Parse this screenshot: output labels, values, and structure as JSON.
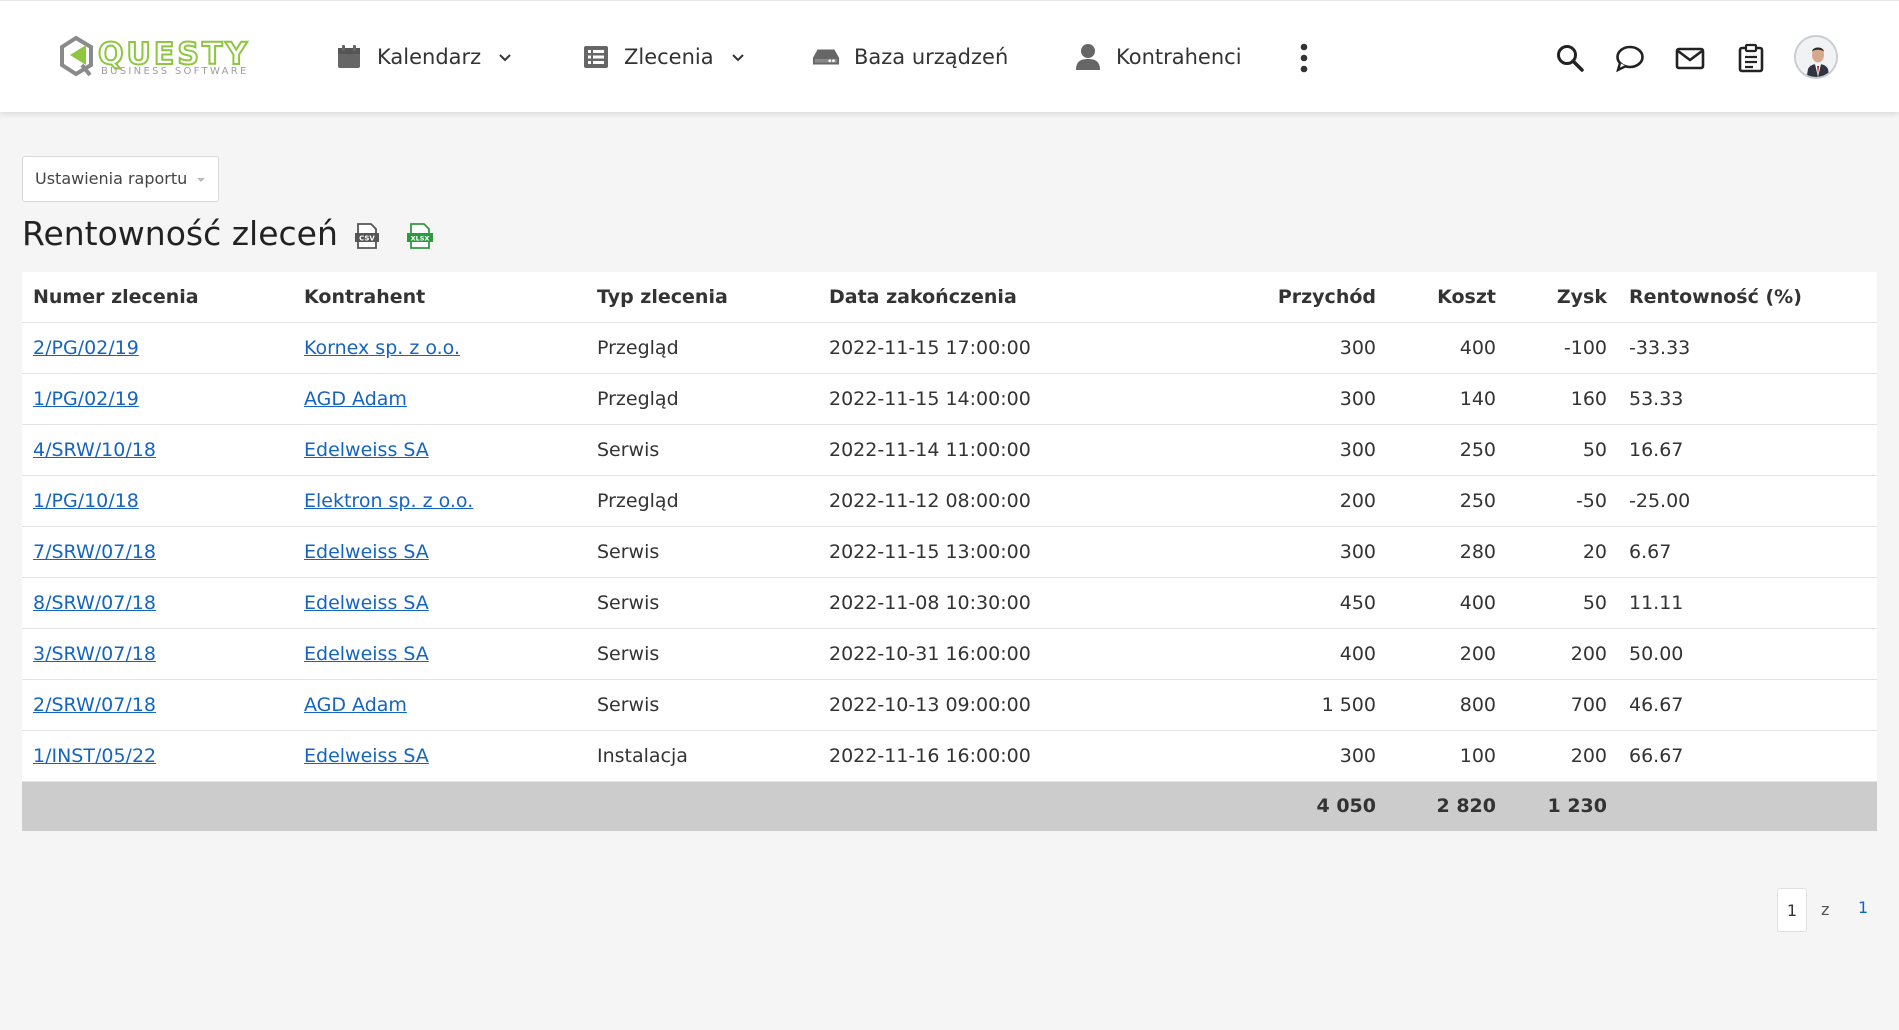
{
  "logo": {
    "name": "QUESTY",
    "tagline": "BUSINESS SOFTWARE",
    "color": "#8dc63f"
  },
  "nav": {
    "items": [
      {
        "label": "Kalendarz",
        "icon": "calendar-icon",
        "dropdown": true
      },
      {
        "label": "Zlecenia",
        "icon": "list-icon",
        "dropdown": true
      },
      {
        "label": "Baza urządzeń",
        "icon": "device-icon",
        "dropdown": false
      },
      {
        "label": "Kontrahenci",
        "icon": "person-icon",
        "dropdown": false
      }
    ],
    "right_icons": [
      "search-icon",
      "chat-icon",
      "mail-icon",
      "clipboard-icon"
    ]
  },
  "report": {
    "settings_label": "Ustawienia raportu",
    "title": "Rentowność zleceń",
    "export_icons": [
      "csv-export-icon",
      "xlsx-export-icon"
    ],
    "columns": [
      "Numer zlecenia",
      "Kontrahent",
      "Typ zlecenia",
      "Data zakończenia",
      "Przychód",
      "Koszt",
      "Zysk",
      "Rentowność (%)"
    ],
    "rows": [
      [
        "2/PG/02/19",
        "Kornex sp. z o.o.",
        "Przegląd",
        "2022-11-15 17:00:00",
        "300",
        "400",
        "-100",
        "-33.33"
      ],
      [
        "1/PG/02/19",
        "AGD Adam",
        "Przegląd",
        "2022-11-15 14:00:00",
        "300",
        "140",
        "160",
        "53.33"
      ],
      [
        "4/SRW/10/18",
        "Edelweiss SA",
        "Serwis",
        "2022-11-14 11:00:00",
        "300",
        "250",
        "50",
        "16.67"
      ],
      [
        "1/PG/10/18",
        "Elektron sp. z o.o.",
        "Przegląd",
        "2022-11-12 08:00:00",
        "200",
        "250",
        "-50",
        "-25.00"
      ],
      [
        "7/SRW/07/18",
        "Edelweiss SA",
        "Serwis",
        "2022-11-15 13:00:00",
        "300",
        "280",
        "20",
        "6.67"
      ],
      [
        "8/SRW/07/18",
        "Edelweiss SA",
        "Serwis",
        "2022-11-08 10:30:00",
        "450",
        "400",
        "50",
        "11.11"
      ],
      [
        "3/SRW/07/18",
        "Edelweiss SA",
        "Serwis",
        "2022-10-31 16:00:00",
        "400",
        "200",
        "200",
        "50.00"
      ],
      [
        "2/SRW/07/18",
        "AGD Adam",
        "Serwis",
        "2022-10-13 09:00:00",
        "1 500",
        "800",
        "700",
        "46.67"
      ],
      [
        "1/INST/05/22",
        "Edelweiss SA",
        "Instalacja",
        "2022-11-16 16:00:00",
        "300",
        "100",
        "200",
        "66.67"
      ]
    ],
    "totals": {
      "przychod": "4 050",
      "koszt": "2 820",
      "zysk": "1 230"
    },
    "colors": {
      "negative": "#e53935",
      "positive": "#43a047",
      "link": "#1565c0",
      "total_bg": "#cccccc"
    }
  },
  "pagination": {
    "current": "1",
    "of": "z",
    "total": "1"
  }
}
